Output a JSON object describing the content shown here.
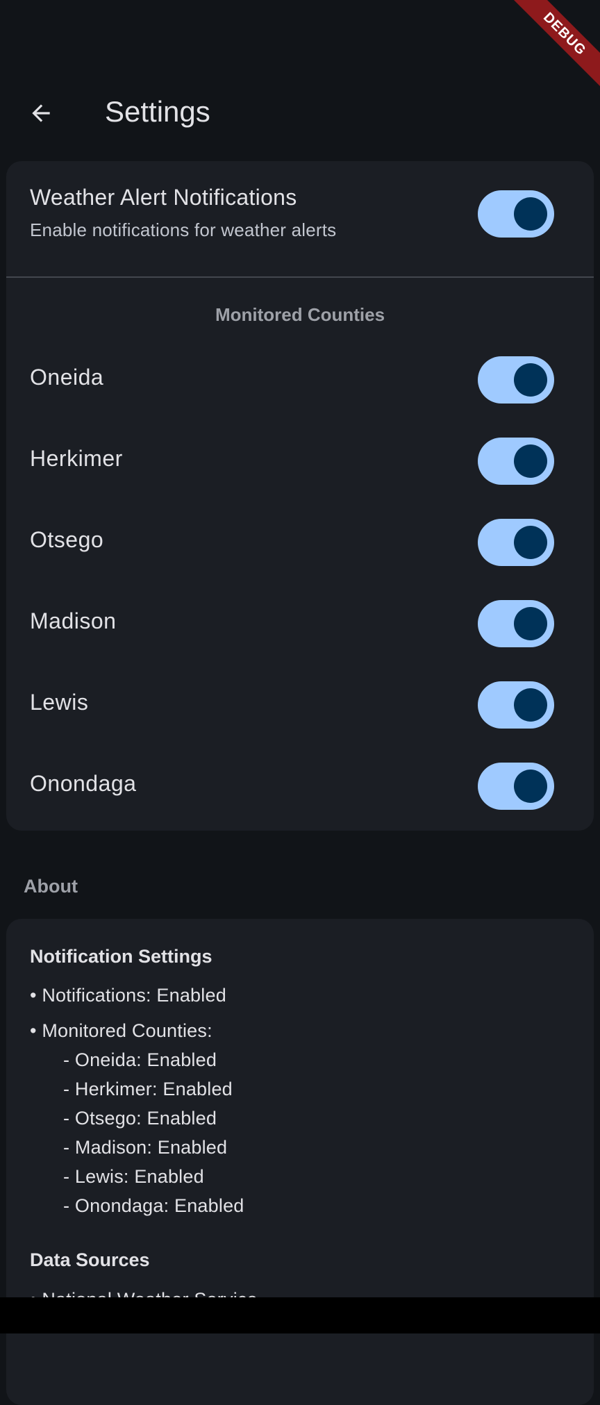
{
  "debug_banner": "DEBUG",
  "appbar": {
    "title": "Settings",
    "back_icon": "arrow-back-icon"
  },
  "notifications": {
    "title": "Weather Alert Notifications",
    "subtitle": "Enable notifications for weather alerts",
    "enabled": true
  },
  "counties": {
    "heading": "Monitored Counties",
    "items": [
      {
        "label": "Oneida",
        "enabled": true
      },
      {
        "label": "Herkimer",
        "enabled": true
      },
      {
        "label": "Otsego",
        "enabled": true
      },
      {
        "label": "Madison",
        "enabled": true
      },
      {
        "label": "Lewis",
        "enabled": true
      },
      {
        "label": "Onondaga",
        "enabled": true
      }
    ]
  },
  "about": {
    "heading": "About",
    "notification_settings_title": "Notification Settings",
    "lines": [
      "• Notifications: Enabled",
      "• Monitored Counties:",
      "- Oneida: Enabled",
      "- Herkimer: Enabled",
      "- Otsego: Enabled",
      "- Madison: Enabled",
      "- Lewis: Enabled",
      "- Onondaga: Enabled"
    ],
    "data_sources_title": "Data Sources",
    "data_sources_lines": [
      "• National Weather Service"
    ]
  },
  "colors": {
    "background": "#111418",
    "card": "#1b1e24",
    "switch_track": "#9fcaff",
    "switch_thumb": "#003258",
    "debug_ribbon": "#8e1a1c"
  }
}
